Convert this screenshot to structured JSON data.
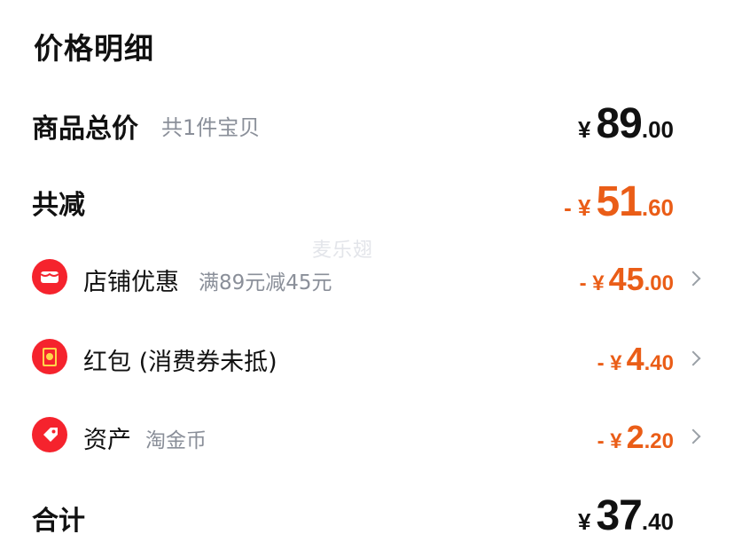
{
  "title": "价格明细",
  "watermark": "麦乐翅",
  "goods_total": {
    "label": "商品总价",
    "sub": "共1件宝贝",
    "currency": "¥",
    "int": "89",
    "dec": ".00"
  },
  "total_discount": {
    "label": "共减",
    "prefix": "- ¥",
    "int": "51",
    "dec": ".60"
  },
  "items": [
    {
      "icon": "store-icon",
      "label": "店铺优惠",
      "sub": "满89元减45元",
      "prefix": "- ¥",
      "int": "45",
      "dec": ".00"
    },
    {
      "icon": "red-envelope-icon",
      "label": "红包 (消费券未抵)",
      "sub": "",
      "prefix": "- ¥",
      "int": "4",
      "dec": ".40"
    },
    {
      "icon": "tag-icon",
      "label": "资产",
      "sub": "淘金币",
      "prefix": "- ¥",
      "int": "2",
      "dec": ".20"
    }
  ],
  "total": {
    "label": "合计",
    "currency": "¥",
    "int": "37",
    "dec": ".40"
  },
  "colors": {
    "accent_orange": "#ea5d17",
    "icon_red": "#f5232d",
    "sub_text": "#8a8f99"
  }
}
